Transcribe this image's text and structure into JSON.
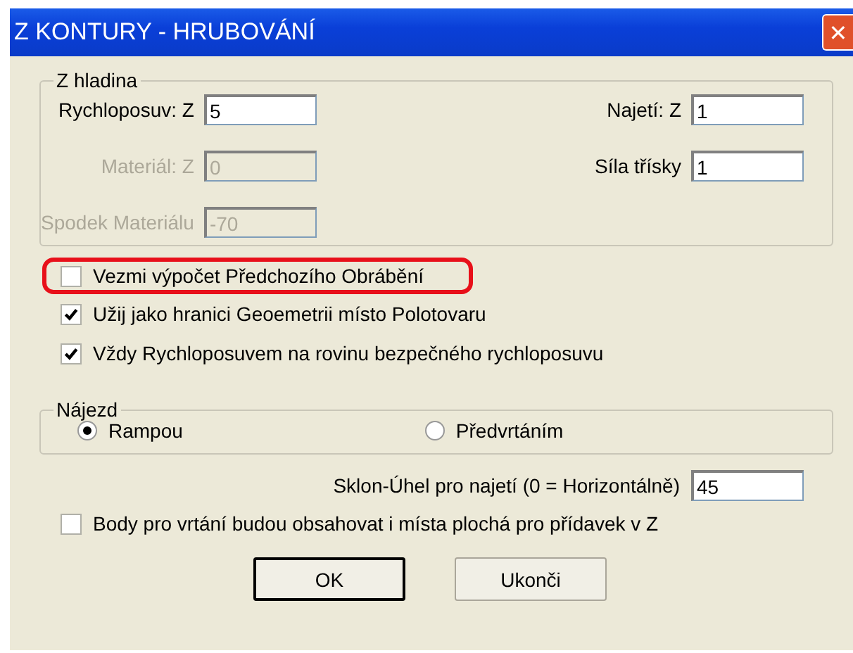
{
  "window": {
    "title": "Z KONTURY - HRUBOVÁNÍ",
    "close": "✕"
  },
  "z_level_group": {
    "title": "Z hladina",
    "left_fields": [
      {
        "label": "Rychloposuv: Z",
        "value": "5",
        "disabled": false
      },
      {
        "label": "Materiál: Z",
        "value": "0",
        "disabled": true
      },
      {
        "label": "Spodek Materiálu",
        "value": "-70",
        "disabled": true
      }
    ],
    "right_fields": [
      {
        "label": "Najetí: Z",
        "value": "1",
        "disabled": false
      },
      {
        "label": "Síla třísky",
        "value": "1",
        "disabled": false
      }
    ]
  },
  "options": [
    {
      "label": "Vezmi výpočet Předchozího Obrábění",
      "checked": false,
      "highlighted": true
    },
    {
      "label": "Užij jako hranici Geoemetrii místo Polotovaru",
      "checked": true,
      "highlighted": false
    },
    {
      "label": "Vždy Rychloposuvem na rovinu bezpečného rychloposuvu",
      "checked": true,
      "highlighted": false
    }
  ],
  "approach_group": {
    "title": "Nájezd",
    "options": [
      {
        "label": "Rampou",
        "selected": true
      },
      {
        "label": "Předvrtáním",
        "selected": false
      }
    ]
  },
  "angle_field": {
    "label": "Sklon-Úhel pro najetí (0 = Horizontálně)",
    "value": "45"
  },
  "flat_points": {
    "label": "Body pro vrtání budou obsahovat i místa plochá pro přídavek v Z",
    "checked": false
  },
  "buttons": [
    {
      "label": "OK",
      "default": true
    },
    {
      "label": "Ukonči",
      "default": false
    }
  ]
}
